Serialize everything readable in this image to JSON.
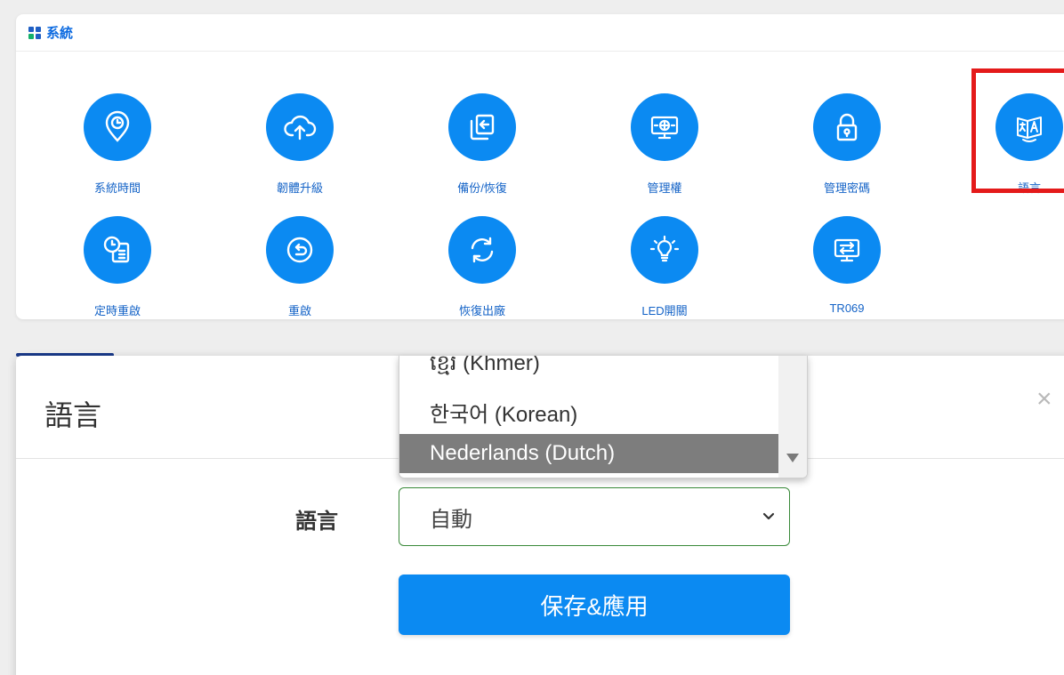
{
  "panel": {
    "title": "系統",
    "grid_icon_colors": [
      "#1f5fc4",
      "#1f5fc4",
      "#12b06a",
      "#1f5fc4"
    ]
  },
  "tiles": [
    {
      "label": "系統時間",
      "icon": "clock-pin-icon"
    },
    {
      "label": "韌體升級",
      "icon": "cloud-upload-icon"
    },
    {
      "label": "備份/恢復",
      "icon": "backup-restore-icon"
    },
    {
      "label": "管理權",
      "icon": "monitor-globe-icon"
    },
    {
      "label": "管理密碼",
      "icon": "lock-icon"
    },
    {
      "label": "語言",
      "icon": "translate-icon"
    },
    {
      "label": "定時重啟",
      "icon": "scheduled-reboot-icon"
    },
    {
      "label": "重啟",
      "icon": "reboot-icon"
    },
    {
      "label": "恢復出廠",
      "icon": "factory-reset-icon"
    },
    {
      "label": "LED開關",
      "icon": "lightbulb-icon"
    },
    {
      "label": "TR069",
      "icon": "monitor-transfer-icon"
    }
  ],
  "modal": {
    "title": "語言",
    "close_glyph": "×",
    "field_label": "語言",
    "select_value": "自動",
    "save_label": "保存&應用"
  },
  "dropdown": {
    "options": [
      "ខ្មែរ (Khmer)",
      "한국어 (Korean)",
      "Nederlands (Dutch)"
    ],
    "selected_index": 2
  },
  "colors": {
    "accent": "#0b8af2",
    "highlight": "#e41a1a",
    "selected_option": "#7d7d7d"
  }
}
